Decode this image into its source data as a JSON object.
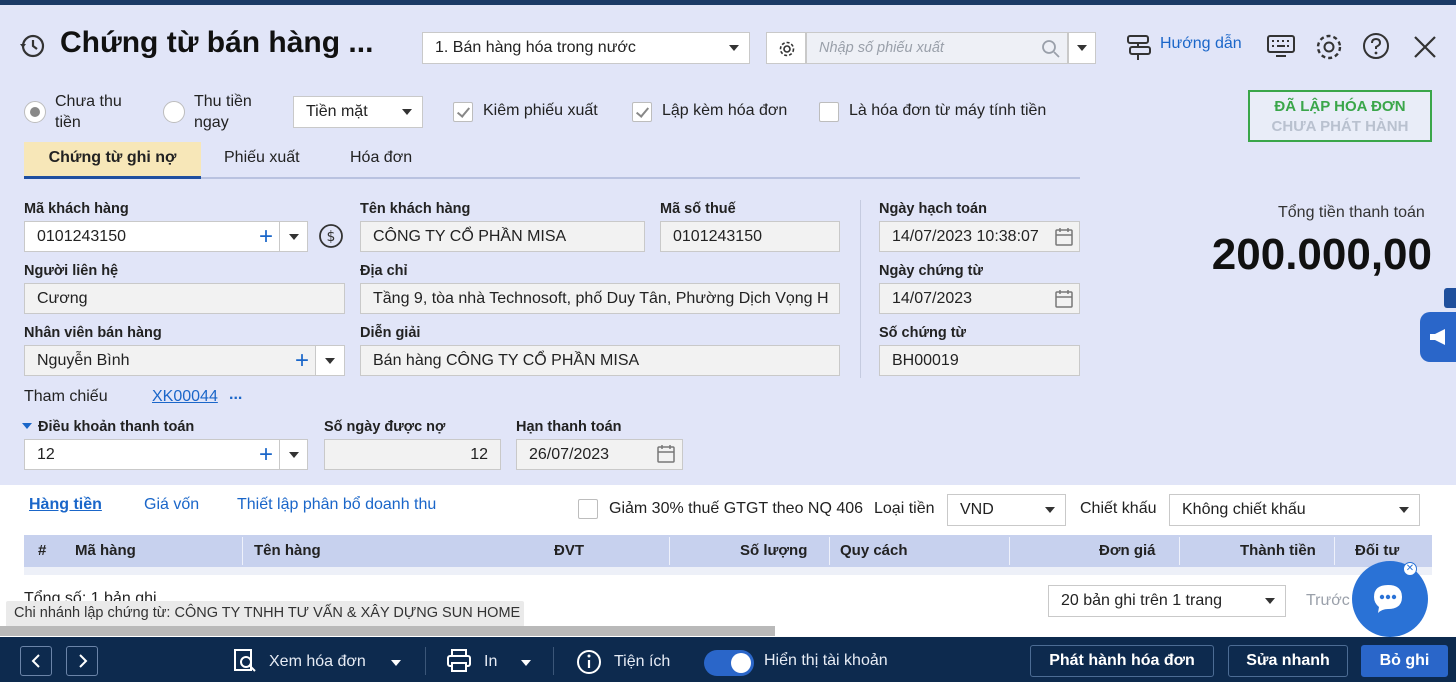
{
  "header": {
    "title": "Chứng từ bán hàng ...",
    "sale_type": "1. Bán hàng hóa trong nước",
    "search_placeholder": "Nhập số phiếu xuất",
    "help_label": "Hướng dẫn"
  },
  "payment": {
    "unpaid_label": "Chưa thu tiền",
    "paid_now_label": "Thu tiền ngay",
    "method": "Tiền mặt",
    "with_dispatch_label": "Kiêm phiếu xuất",
    "with_invoice_label": "Lập kèm hóa đơn",
    "cash_register_label": "Là hóa đơn từ máy tính tiền",
    "selected": "unpaid"
  },
  "stamp": {
    "line1": "ĐÃ LẬP HÓA ĐƠN",
    "line2": "CHƯA PHÁT HÀNH"
  },
  "tabs": [
    "Chứng từ ghi nợ",
    "Phiếu xuất",
    "Hóa đơn"
  ],
  "form": {
    "customer_code_label": "Mã khách hàng",
    "customer_code": "0101243150",
    "customer_name_label": "Tên khách hàng",
    "customer_name": "CÔNG TY CỔ PHẦN MISA",
    "tax_code_label": "Mã số thuế",
    "tax_code": "0101243150",
    "contact_label": "Người liên hệ",
    "contact": "Cương",
    "address_label": "Địa chỉ",
    "address": "Tầng 9, tòa nhà Technosoft, phố Duy Tân, Phường Dịch Vọng H",
    "salesperson_label": "Nhân viên bán hàng",
    "salesperson": "Nguyễn Bình",
    "description_label": "Diễn giải",
    "description": "Bán hàng CÔNG TY CỔ PHẦN MISA",
    "reference_label": "Tham chiếu",
    "reference": "XK00044",
    "reference_more": "...",
    "posting_date_label": "Ngày hạch toán",
    "posting_date": "14/07/2023 10:38:07",
    "voucher_date_label": "Ngày chứng từ",
    "voucher_date": "14/07/2023",
    "voucher_no_label": "Số chứng từ",
    "voucher_no": "BH00019",
    "payment_terms_label": "Điều khoản thanh toán",
    "payment_terms": "12",
    "credit_days_label": "Số ngày được nợ",
    "credit_days": "12",
    "due_date_label": "Hạn thanh toán",
    "due_date": "26/07/2023"
  },
  "total": {
    "label": "Tổng tiền thanh toán",
    "value": "200.000,00"
  },
  "detail_tabs": [
    "Hàng tiền",
    "Giá vốn",
    "Thiết lập phân bổ doanh thu"
  ],
  "options": {
    "vat_reduction_label": "Giảm 30% thuế GTGT theo NQ 406",
    "currency_label": "Loại tiền",
    "currency": "VND",
    "discount_label": "Chiết khấu",
    "discount": "Không chiết khấu"
  },
  "grid": {
    "columns": [
      "#",
      "Mã hàng",
      "Tên hàng",
      "ĐVT",
      "Số lượng",
      "Quy cách",
      "Đơn giá",
      "Thành tiền",
      "Đối tư"
    ],
    "summary": "Tổng số: 1 bản ghi",
    "page_size": "20 bản ghi trên 1 trang",
    "prev_label": "Trước"
  },
  "branch_note": "Chi nhánh lập chứng từ: CÔNG TY TNHH TƯ VẤN & XÂY DỰNG SUN HOME",
  "footer": {
    "view_invoice": "Xem hóa đơn",
    "print": "In",
    "utilities": "Tiện ích",
    "show_account": "Hiển thị tài khoản",
    "issue_invoice": "Phát hành hóa đơn",
    "quick_edit": "Sửa nhanh",
    "unpost": "Bỏ ghi"
  },
  "colors": {
    "accent": "#1a66c9",
    "footer_bg": "#0d2a4e",
    "stamp_green": "#3aa64a",
    "primary_button": "#2a66c9"
  }
}
